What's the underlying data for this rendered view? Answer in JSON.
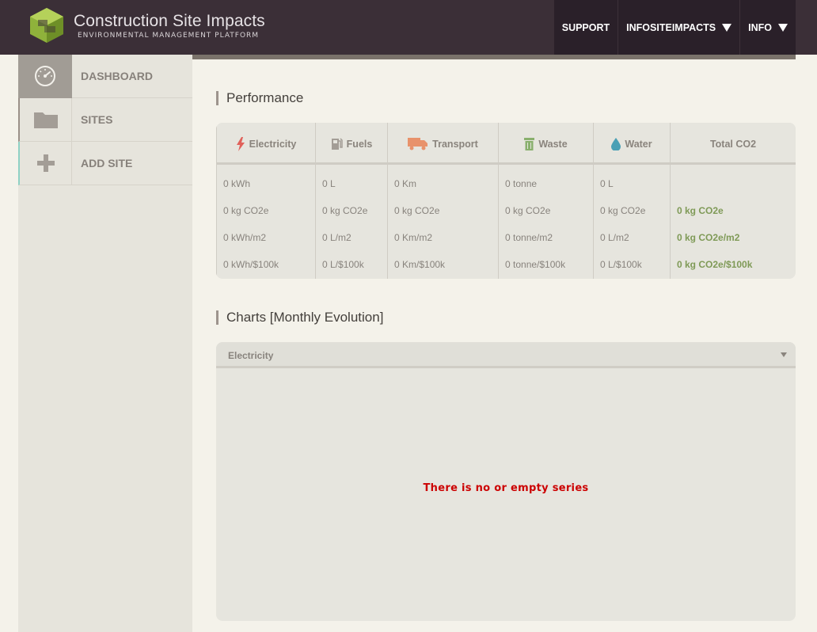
{
  "header": {
    "title": "Construction Site Impacts",
    "subtitle": "ENVIRONMENTAL MANAGEMENT PLATFORM",
    "nav": [
      {
        "label": "SUPPORT",
        "has_caret": false
      },
      {
        "label": "INFOSITEIMPACTS",
        "has_caret": true
      },
      {
        "label": "INFO",
        "has_caret": true
      }
    ]
  },
  "sidebar": {
    "items": [
      {
        "label": "DASHBOARD",
        "icon": "dashboard-gauge-icon"
      },
      {
        "label": "SITES",
        "icon": "folder-icon"
      },
      {
        "label": "ADD SITE",
        "icon": "plus-icon"
      }
    ]
  },
  "performance": {
    "title": "Performance",
    "columns": [
      {
        "label": "Electricity",
        "icon": "lightning-icon",
        "values": [
          "0 kWh",
          "0 kg CO2e",
          "0 kWh/m2",
          "0 kWh/$100k"
        ]
      },
      {
        "label": "Fuels",
        "icon": "fuel-pump-icon",
        "values": [
          "0 L",
          "0 kg CO2e",
          "0 L/m2",
          "0 L/$100k"
        ]
      },
      {
        "label": "Transport",
        "icon": "truck-icon",
        "values": [
          "0 Km",
          "0 kg CO2e",
          "0 Km/m2",
          "0 Km/$100k"
        ]
      },
      {
        "label": "Waste",
        "icon": "trash-icon",
        "values": [
          "0 tonne",
          "0 kg CO2e",
          "0 tonne/m2",
          "0 tonne/$100k"
        ]
      },
      {
        "label": "Water",
        "icon": "water-drop-icon",
        "values": [
          "0 L",
          "0 kg CO2e",
          "0 L/m2",
          "0 L/$100k"
        ]
      },
      {
        "label": "Total CO2",
        "icon": "",
        "values": [
          "",
          "0 kg CO2e",
          "0 kg CO2e/m2",
          "0 kg CO2e/$100k"
        ]
      }
    ]
  },
  "charts": {
    "title": "Charts [Monthly Evolution]",
    "selected": "Electricity",
    "empty_message": "There is no or empty series"
  },
  "colors": {
    "header_bg": "#3b2f37",
    "total_accent": "#7f9a57",
    "error_text": "#cc0000",
    "electricity": "#e0615a",
    "transport": "#e8926b",
    "waste": "#89b06d",
    "water": "#4aa0b5"
  }
}
